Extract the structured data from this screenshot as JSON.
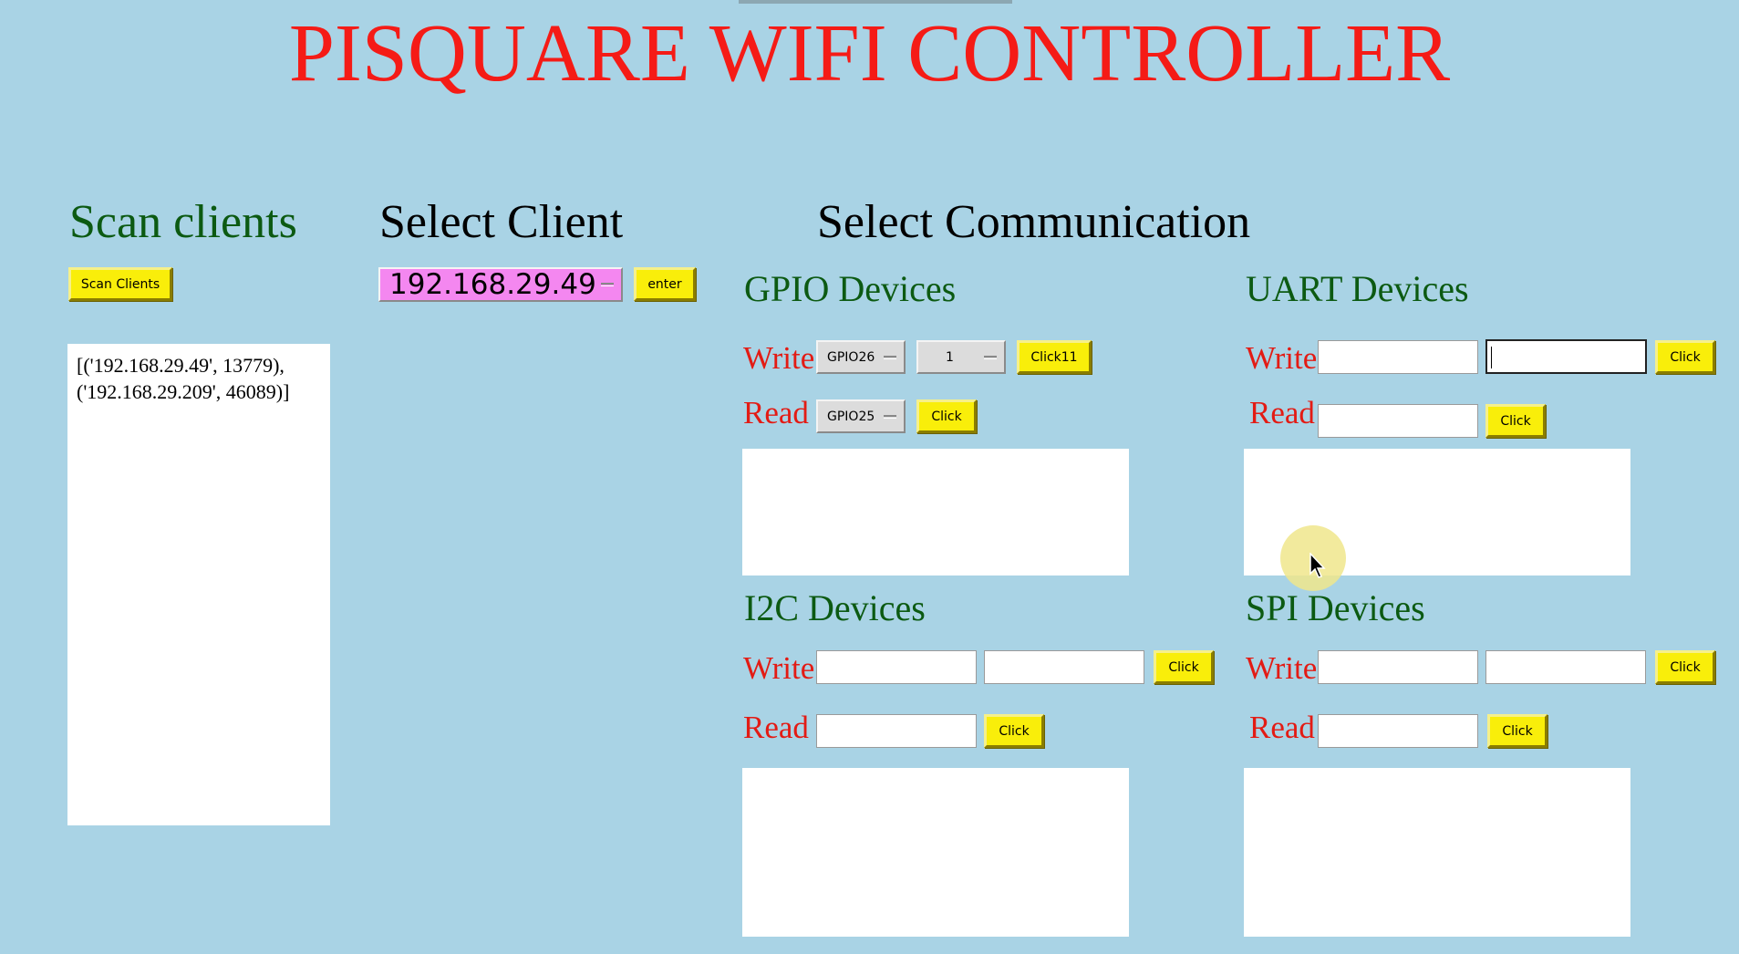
{
  "app": {
    "title": "PISQUARE WIFI CONTROLLER"
  },
  "scan": {
    "heading": "Scan clients",
    "button_label": "Scan Clients",
    "output_text": "[('192.168.29.49', 13779),\n('192.168.29.209', 46089)]"
  },
  "client": {
    "heading": "Select Client",
    "selected": "192.168.29.49",
    "enter_label": "enter"
  },
  "communication": {
    "heading": "Select Communication"
  },
  "gpio": {
    "heading": "GPIO Devices",
    "write_label": "Write",
    "read_label": "Read",
    "write_pin": "GPIO26",
    "write_value": "1",
    "write_button": "Click11",
    "read_pin": "GPIO25",
    "read_button": "Click"
  },
  "uart": {
    "heading": "UART Devices",
    "write_label": "Write",
    "read_label": "Read",
    "write_button": "Click",
    "read_button": "Click"
  },
  "i2c": {
    "heading": "I2C Devices",
    "write_label": "Write",
    "read_label": "Read",
    "write_button": "Click",
    "read_button": "Click"
  },
  "spi": {
    "heading": "SPI Devices",
    "write_label": "Write",
    "read_label": "Read",
    "write_button": "Click",
    "read_button": "Click"
  },
  "colors": {
    "background": "#a9d3e5",
    "title": "#f51b16",
    "heading_green": "#0c5a12",
    "label_red": "#e31b14",
    "button_yellow": "#f9ee0a",
    "client_combo": "#f487f0"
  }
}
